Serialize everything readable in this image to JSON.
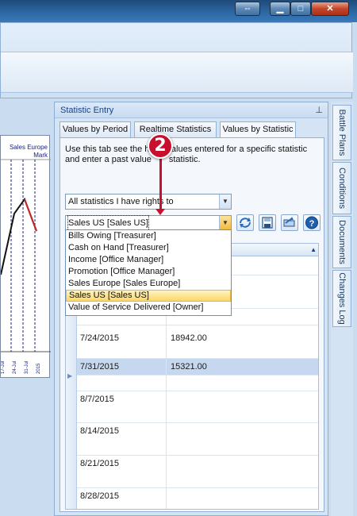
{
  "panel": {
    "title": "Statistic Entry",
    "pin_icon": "pin-icon",
    "tabs": [
      {
        "label": "Values by Period"
      },
      {
        "label": "Realtime Statistics"
      },
      {
        "label": "Values by Statistic"
      }
    ],
    "description_part1": "Use this tab see the h",
    "description_part2": "values entered for a specific statistic",
    "description_line2_part1": "and enter a past value",
    "description_line2_part2": "statistic.",
    "filter_combo": {
      "value": "All statistics I have rights to"
    },
    "statistic_combo": {
      "value": "Sales US [Sales US]"
    },
    "dropdown_items": [
      "Bills Owing [Treasurer]",
      "Cash on Hand [Treasurer]",
      "Income [Office Manager]",
      "Promotion [Office Manager]",
      "Sales Europe [Sales Europe]",
      "Sales US [Sales US]",
      "Value of Service Delivered [Owner]"
    ],
    "selected_dropdown_index": 5
  },
  "grid": {
    "rows": [
      {
        "date": "7/24/2015",
        "value": "18942.00"
      },
      {
        "date": "7/31/2015",
        "value": "15321.00"
      },
      {
        "date": "8/7/2015",
        "value": ""
      },
      {
        "date": "8/14/2015",
        "value": ""
      },
      {
        "date": "8/21/2015",
        "value": ""
      },
      {
        "date": "8/28/2015",
        "value": ""
      }
    ]
  },
  "side_tabs": [
    "Battle Plans",
    "Conditions",
    "Documents",
    "Changes Log"
  ],
  "left_chart": {
    "label_line1": "Sales Europe",
    "label_line2": "Mark"
  },
  "callout": {
    "number": "2"
  },
  "colors": {
    "callout": "#c8102e",
    "line_red": "#c62828",
    "line_black": "#111111",
    "axis_blue": "#1a237e"
  }
}
